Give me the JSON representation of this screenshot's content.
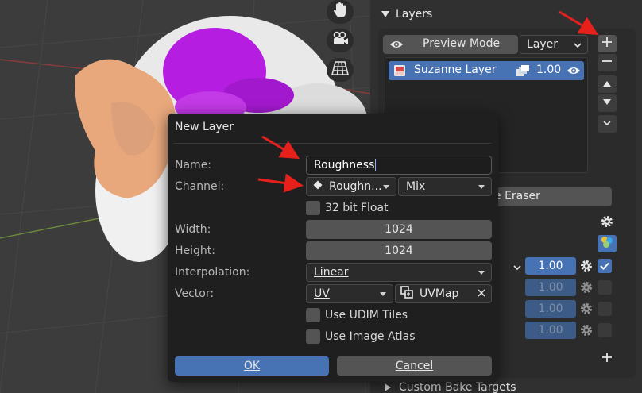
{
  "panel": {
    "header": "Layers",
    "preview_mode": "Preview Mode",
    "layer_dropdown": "Layer",
    "layers": [
      {
        "name": "Suzanne Layer",
        "opacity": "1.00"
      }
    ],
    "eraser_button": "e Eraser",
    "channel_values": [
      "1.00",
      "1.00",
      "1.00",
      "1.00"
    ],
    "custom_bake_targets": "Custom Bake Targets"
  },
  "dialog": {
    "title": "New Layer",
    "name_label": "Name:",
    "name_value": "Roughness",
    "channel_label": "Channel:",
    "channel_value": "Roughn...",
    "blend_value": "Mix",
    "float_label": "32 bit Float",
    "width_label": "Width:",
    "width_value": "1024",
    "height_label": "Height:",
    "height_value": "1024",
    "interp_label": "Interpolation:",
    "interp_value": "Linear",
    "vector_label": "Vector:",
    "vector_value": "UV",
    "uvmap_value": "UVMap",
    "udim_label": "Use UDIM Tiles",
    "atlas_label": "Use Image Atlas",
    "ok_label": "OK",
    "cancel_label": "Cancel"
  },
  "colors": {
    "accent": "#4772b3",
    "annotation_arrow": "#e8201c",
    "paint_purple": "#b51ee0"
  },
  "icons": [
    "hand-icon",
    "camera-icon",
    "grid-icon",
    "eye-icon",
    "plus-icon",
    "minus-icon",
    "arrow-up-icon",
    "arrow-down-icon",
    "chevron-down-icon",
    "gear-icon",
    "color-circles-icon",
    "image-layer-icon",
    "opacity-icon",
    "diamond-icon",
    "uvmap-icon",
    "close-icon"
  ]
}
